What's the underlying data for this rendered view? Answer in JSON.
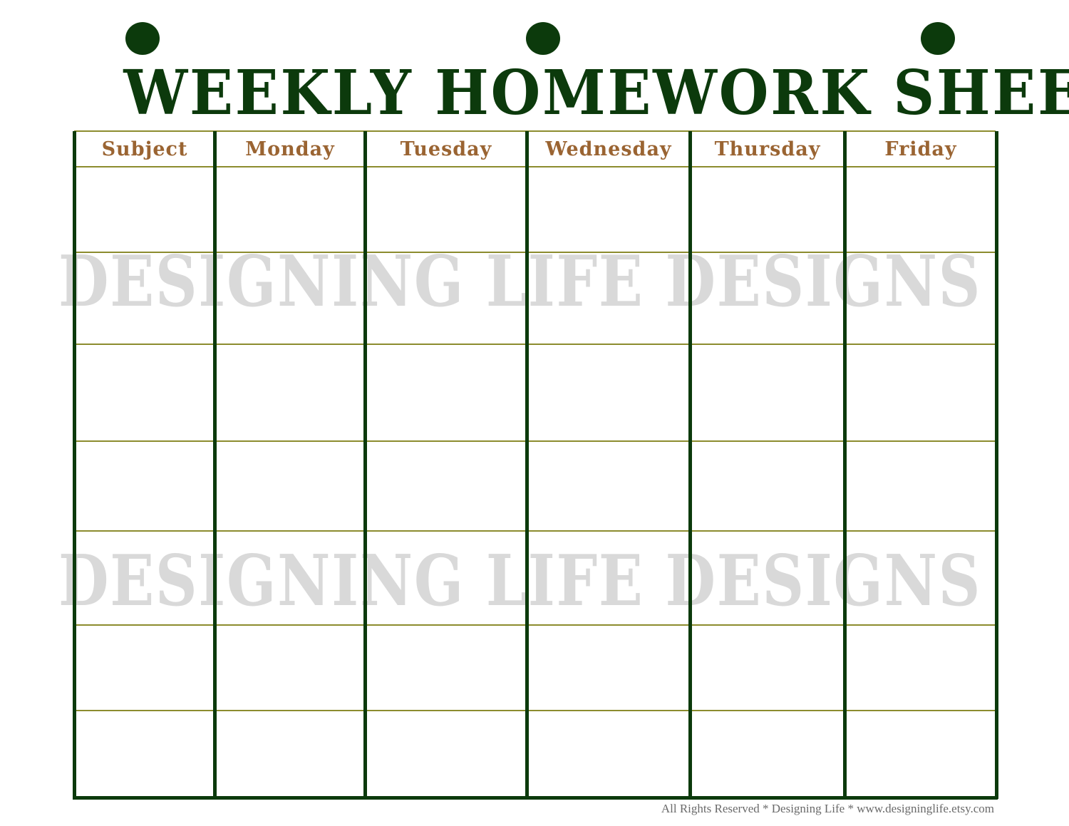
{
  "title": "WEEKLY HOMEWORK SHEET",
  "binder_holes": [
    "hole-left",
    "hole-center",
    "hole-right"
  ],
  "table": {
    "columns": [
      "Subject",
      "Monday",
      "Tuesday",
      "Wednesday",
      "Thursday",
      "Friday"
    ],
    "rows": [
      [
        "",
        "",
        "",
        "",
        "",
        ""
      ],
      [
        "",
        "",
        "",
        "",
        "",
        ""
      ],
      [
        "",
        "",
        "",
        "",
        "",
        ""
      ],
      [
        "",
        "",
        "",
        "",
        "",
        ""
      ],
      [
        "",
        "",
        "",
        "",
        "",
        ""
      ],
      [
        "",
        "",
        "",
        "",
        "",
        ""
      ],
      [
        "",
        "",
        "",
        "",
        "",
        ""
      ]
    ]
  },
  "watermark": [
    "DESIGNING LIFE DESIGNS",
    "DESIGNING LIFE DESIGNS"
  ],
  "footer": "All Rights Reserved * Designing Life * www.designinglife.etsy.com",
  "colors": {
    "title": "#0c3a0c",
    "header_text": "#9a6432",
    "row_lines": "#8c8c2e",
    "column_lines": "#0c3a0c",
    "watermark": "#d9d9d9"
  }
}
